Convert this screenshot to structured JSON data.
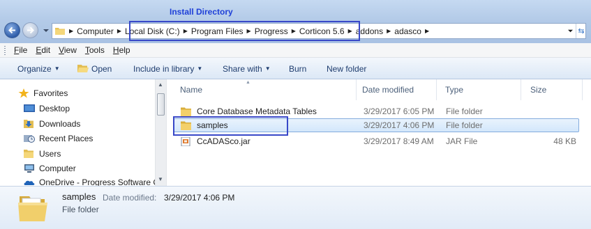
{
  "annotation": {
    "install_directory_label": "Install Directory"
  },
  "address_bar": {
    "crumbs": [
      "Computer",
      "Local Disk (C:)",
      "Program Files",
      "Progress",
      "Corticon 5.6",
      "addons",
      "adasco"
    ]
  },
  "menu": {
    "items": [
      {
        "accel": "F",
        "rest": "ile"
      },
      {
        "accel": "E",
        "rest": "dit"
      },
      {
        "accel": "V",
        "rest": "iew"
      },
      {
        "accel": "T",
        "rest": "ools"
      },
      {
        "accel": "H",
        "rest": "elp"
      }
    ]
  },
  "toolbar": {
    "organize": "Organize",
    "open": "Open",
    "include_in_library": "Include in library",
    "share_with": "Share with",
    "burn": "Burn",
    "new_folder": "New folder"
  },
  "nav_pane": {
    "items": [
      {
        "label": "Favorites",
        "icon": "star-icon"
      },
      {
        "label": "Desktop",
        "icon": "desktop-icon"
      },
      {
        "label": "Downloads",
        "icon": "downloads-icon"
      },
      {
        "label": "Recent Places",
        "icon": "recent-places-icon"
      },
      {
        "label": "Users",
        "icon": "folder-icon"
      },
      {
        "label": "Computer",
        "icon": "computer-icon"
      },
      {
        "label": "OneDrive - Progress Software C",
        "icon": "onedrive-icon"
      }
    ]
  },
  "file_list": {
    "columns": {
      "name": "Name",
      "date": "Date modified",
      "type": "Type",
      "size": "Size"
    },
    "rows": [
      {
        "name": "Core Database Metadata Tables",
        "date": "3/29/2017 6:05 PM",
        "type": "File folder",
        "size": "",
        "icon": "folder-icon",
        "selected": false
      },
      {
        "name": "samples",
        "date": "3/29/2017 4:06 PM",
        "type": "File folder",
        "size": "",
        "icon": "folder-icon",
        "selected": true
      },
      {
        "name": "CcADASco.jar",
        "date": "3/29/2017 8:49 AM",
        "type": "JAR File",
        "size": "48 KB",
        "icon": "jar-file-icon",
        "selected": false
      }
    ]
  },
  "details": {
    "name": "samples",
    "date_label": "Date modified:",
    "date_value": "3/29/2017 4:06 PM",
    "type": "File folder"
  },
  "colors": {
    "highlight_box": "#3848c8",
    "annotation_text": "#1f40d8",
    "selection_border": "#84acdd"
  }
}
